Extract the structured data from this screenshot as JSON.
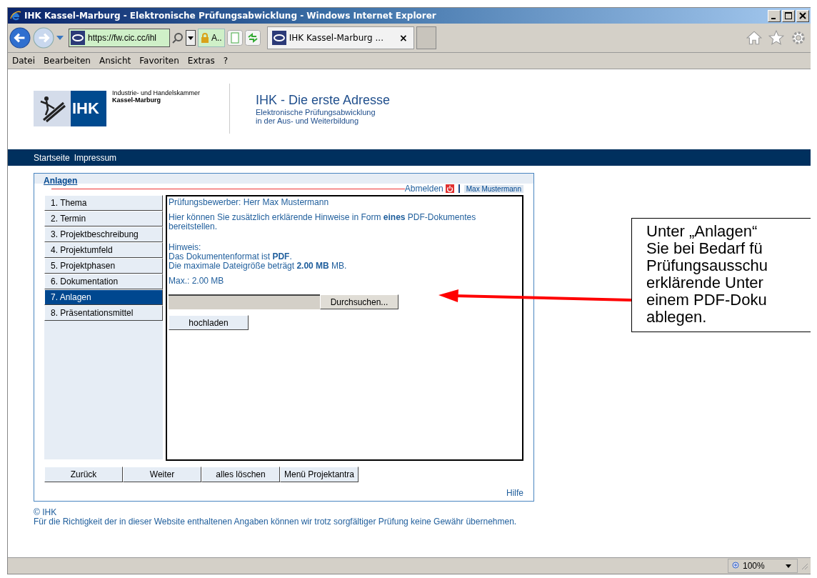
{
  "window": {
    "title": "IHK Kassel-Marburg - Elektronische Prüfungsabwicklung - Windows Internet Explorer"
  },
  "address_bar": {
    "value": "https://fw.cic.cc/ihl",
    "security": "A.."
  },
  "tabs": [
    {
      "label": "IHK Kassel-Marburg ...",
      "selected": true,
      "close": "×"
    }
  ],
  "menu": [
    "Datei",
    "Bearbeiten",
    "Ansicht",
    "Favoriten",
    "Extras",
    "?"
  ],
  "header": {
    "org_line1": "Industrie- und Handelskammer",
    "org_line2": "Kassel-Marburg",
    "logo_text": "IHK",
    "title": "IHK - Die erste Adresse",
    "subtitle_1": "Elektronische Prüfungsabwicklung",
    "subtitle_2": "in der Aus- und Weiterbildung"
  },
  "nav": [
    "Startseite",
    "Impressum"
  ],
  "panel": {
    "title": "Anlagen",
    "logout": "Abmelden",
    "user": "Max Mustermann",
    "help": "Hilfe"
  },
  "steps": [
    {
      "label": "1. Thema",
      "selected": false
    },
    {
      "label": "2. Termin",
      "selected": false
    },
    {
      "label": "3. Projektbeschreibung",
      "selected": false
    },
    {
      "label": "4. Projektumfeld",
      "selected": false
    },
    {
      "label": "5. Projektphasen",
      "selected": false
    },
    {
      "label": "6. Dokumentation",
      "selected": false
    },
    {
      "label": "7. Anlagen",
      "selected": true
    },
    {
      "label": "8. Präsentationsmittel",
      "selected": false
    }
  ],
  "content": {
    "applicant": "Prüfungsbewerber: Herr Max Mustermann",
    "intro": "Hier können Sie zusätzlich erklärende Hinweise in Form **eines** PDF-Dokumentes bereitstellen.",
    "hint_title": "Hinweis:",
    "hint_format": "Das Dokumentenformat ist **PDF**.",
    "hint_size": "Die maximale Dateigröße beträgt **2.00 MB** MB.",
    "max": "Max.: 2.00 MB",
    "browse": "Durchsuchen...",
    "upload": "hochladen"
  },
  "buttons": [
    "Zurück",
    "Weiter",
    "alles löschen",
    "Menü Projektantra"
  ],
  "footer": {
    "copyright": "© IHK",
    "disclaimer": "Für die Richtigkeit der in dieser Website enthaltenen Angaben können wir trotz sorgfältiger Prüfung keine Gewähr übernehmen."
  },
  "callout": {
    "lines": [
      "Unter „Anlagen“",
      "Sie bei Bedarf fü",
      "Prüfungsausschu",
      "erklärende Unter",
      "einem PDF-Doku",
      "ablegen."
    ]
  },
  "status_bar": {
    "zoom": "100%"
  }
}
